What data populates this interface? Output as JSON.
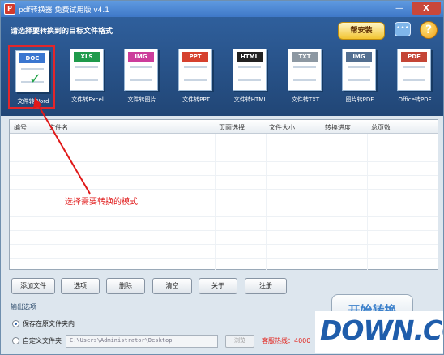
{
  "window": {
    "title": "pdf转换器 免费试用版 v4.1",
    "app_icon": "pdf-logo-icon",
    "minimize": "—",
    "close": "X"
  },
  "header": {
    "prompt": "请选择要转换到的目标文件格式",
    "bang_button": "帮安装",
    "chat_icon": "chat-icon",
    "help_icon": "help-icon",
    "help_glyph": "?"
  },
  "modes": [
    {
      "tag": "DOC",
      "label": "文件转Word",
      "color": "#3a76d0",
      "icon": "word-document-icon",
      "selected": true
    },
    {
      "tag": "XLS",
      "label": "文件转Excel",
      "color": "#1f9a4b",
      "icon": "excel-document-icon",
      "selected": false
    },
    {
      "tag": "IMG",
      "label": "文件转图片",
      "color": "#cc3d9b",
      "icon": "image-document-icon",
      "selected": false
    },
    {
      "tag": "PPT",
      "label": "文件转PPT",
      "color": "#d6412e",
      "icon": "ppt-document-icon",
      "selected": false
    },
    {
      "tag": "HTML",
      "label": "文件转HTML",
      "color": "#222222",
      "icon": "html-document-icon",
      "selected": false
    },
    {
      "tag": "TXT",
      "label": "文件转TXT",
      "color": "#8d98a2",
      "icon": "txt-document-icon",
      "selected": false
    },
    {
      "tag": "IMG",
      "label": "图片转PDF",
      "color": "#536f91",
      "icon": "image-to-pdf-icon",
      "selected": false
    },
    {
      "tag": "PDF",
      "label": "Office转PDF",
      "color": "#c44536",
      "icon": "office-to-pdf-icon",
      "selected": false
    }
  ],
  "file_list": {
    "columns": [
      "编号",
      "文件名",
      "页面选择",
      "文件大小",
      "转换进度",
      "总页数"
    ]
  },
  "hint": "选择需要转换的模式",
  "toolbar": {
    "add_file": "添加文件",
    "options": "选项",
    "delete": "删除",
    "clear": "清空",
    "about": "关于",
    "register": "注册"
  },
  "output": {
    "title": "输出选项",
    "save_original": "保存在原文件夹内",
    "custom_folder": "自定义文件夹",
    "path": "C:\\Users\\Administrator\\Desktop",
    "browse": "浏览",
    "status": "客服热线：4000"
  },
  "start_button": "开始转换",
  "watermark": "DOWN.CC"
}
